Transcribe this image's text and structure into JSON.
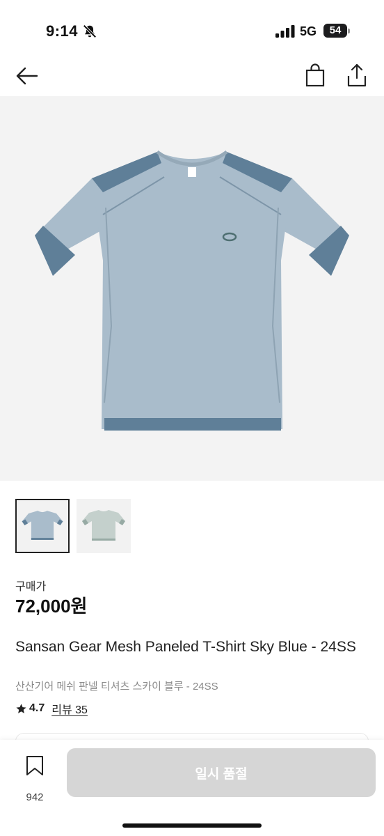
{
  "status_bar": {
    "time": "9:14",
    "network": "5G",
    "battery": "54",
    "icons": [
      "bell-off-icon",
      "signal-icon",
      "battery-icon"
    ]
  },
  "header": {
    "icons": [
      "back-arrow-icon",
      "shopping-bag-icon",
      "share-icon"
    ]
  },
  "product": {
    "price_label": "구매가",
    "price": "72,000원",
    "name_en": "Sansan Gear Mesh Paneled T-Shirt Sky Blue - 24SS",
    "name_ko": "산산기어 메쉬 판넬 티셔츠 스카이 블루 - 24SS",
    "rating": "4.7",
    "review_label": "리뷰 35",
    "thumbnail_count": 2,
    "colors": {
      "shirt_main": "#a9bccb",
      "shirt_panel": "#5f7f98",
      "thumb2_main": "#c4d0cc"
    }
  },
  "bottom_bar": {
    "wish_count": "942",
    "action_label": "일시 품절",
    "action_color": "#d6d6d6"
  }
}
